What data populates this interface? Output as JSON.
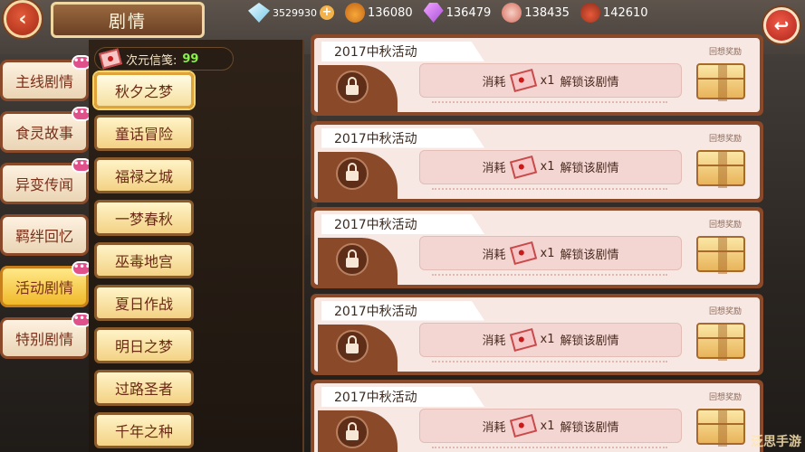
{
  "header": {
    "title": "剧情",
    "back_icon": "back-arrow-icon",
    "return_icon": "return-arrow-icon"
  },
  "resources": [
    {
      "name": "diamond",
      "icon": "diamond-icon",
      "value": "3529930"
    },
    {
      "name": "bottle",
      "icon": "bottle-icon",
      "value": "136080"
    },
    {
      "name": "gem",
      "icon": "purple-gem-icon",
      "value": "136479"
    },
    {
      "name": "meat",
      "icon": "meat-icon",
      "value": "138435"
    },
    {
      "name": "pot",
      "icon": "pot-icon",
      "value": "142610"
    }
  ],
  "currency": {
    "label": "次元信笺:",
    "value": "99"
  },
  "categories": [
    {
      "label": "主线剧情",
      "badge": "•••",
      "active": false
    },
    {
      "label": "食灵故事",
      "badge": "•••",
      "active": false
    },
    {
      "label": "异变传闻",
      "badge": "•••",
      "active": false
    },
    {
      "label": "羁绊回忆",
      "badge": "",
      "active": false
    },
    {
      "label": "活动剧情",
      "badge": "•••",
      "active": true
    },
    {
      "label": "特别剧情",
      "badge": "•••",
      "active": false
    }
  ],
  "stories": [
    {
      "label": "秋夕之梦",
      "active": true
    },
    {
      "label": "童话冒险",
      "active": false
    },
    {
      "label": "福禄之城",
      "active": false
    },
    {
      "label": "一梦春秋",
      "active": false
    },
    {
      "label": "巫毒地宫",
      "active": false
    },
    {
      "label": "夏日作战",
      "active": false
    },
    {
      "label": "明日之梦",
      "active": false
    },
    {
      "label": "过路圣者",
      "active": false
    },
    {
      "label": "千年之种",
      "active": false
    }
  ],
  "cards": [
    {
      "title": "2017中秋活动",
      "cost_prefix": "消耗",
      "cost_qty": "x1",
      "cost_action": "解锁该剧情",
      "reward_label": "回想奖励"
    },
    {
      "title": "2017中秋活动",
      "cost_prefix": "消耗",
      "cost_qty": "x1",
      "cost_action": "解锁该剧情",
      "reward_label": "回想奖励"
    },
    {
      "title": "2017中秋活动",
      "cost_prefix": "消耗",
      "cost_qty": "x1",
      "cost_action": "解锁该剧情",
      "reward_label": "回想奖励"
    },
    {
      "title": "2017中秋活动",
      "cost_prefix": "消耗",
      "cost_qty": "x1",
      "cost_action": "解锁该剧情",
      "reward_label": "回想奖励"
    },
    {
      "title": "2017中秋活动",
      "cost_prefix": "消耗",
      "cost_qty": "x1",
      "cost_action": "解锁该剧情",
      "reward_label": "回想奖励"
    }
  ],
  "watermark": "泛思手游"
}
